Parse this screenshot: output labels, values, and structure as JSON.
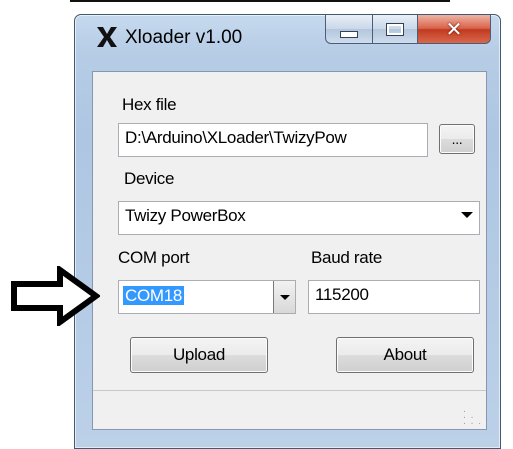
{
  "window": {
    "title": "Xloader v1.00",
    "logo_icon": "x-logo-icon",
    "controls": [
      "minimize-icon",
      "maximize-icon",
      "close-icon"
    ]
  },
  "form": {
    "hex_file_label": "Hex file",
    "hex_file_value": "D:\\Arduino\\XLoader\\TwizyPow",
    "browse_label": "...",
    "device_label": "Device",
    "device_value": "Twizy PowerBox",
    "com_port_label": "COM port",
    "com_port_value": "COM18",
    "baud_rate_label": "Baud rate",
    "baud_rate_value": "115200",
    "upload_label": "Upload",
    "about_label": "About"
  },
  "annotation": {
    "arrow_icon": "right-arrow-icon"
  }
}
